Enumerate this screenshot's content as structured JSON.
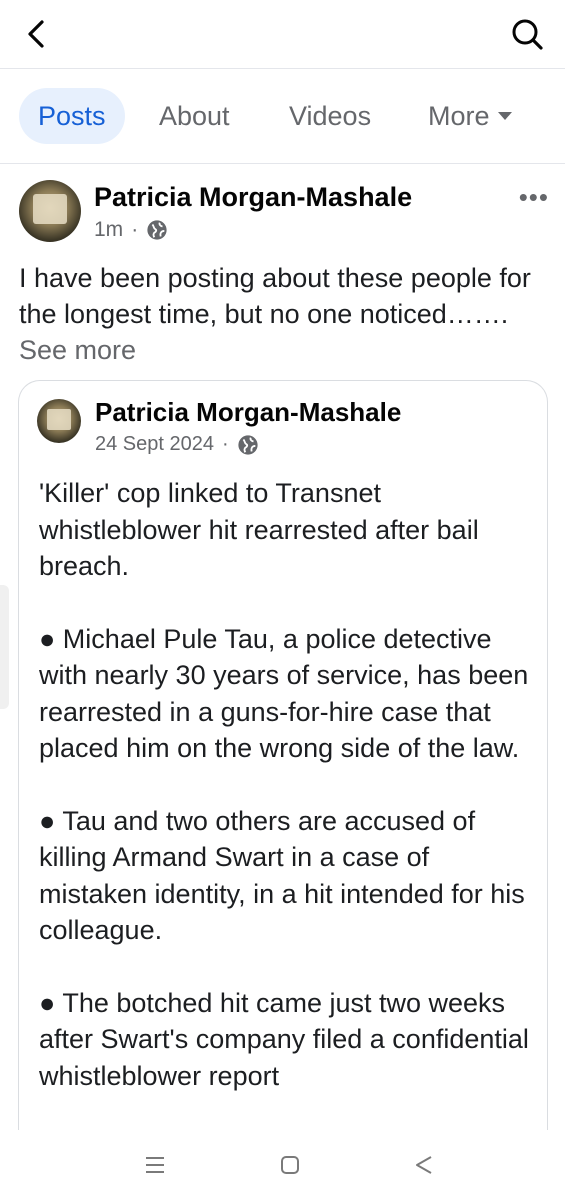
{
  "header": {
    "back_icon": "chevron-left-icon",
    "search_icon": "search-icon"
  },
  "tabs": [
    {
      "label": "Posts",
      "active": true
    },
    {
      "label": "About",
      "active": false
    },
    {
      "label": "Videos",
      "active": false
    },
    {
      "label": "More",
      "active": false
    }
  ],
  "post": {
    "author": "Patricia Morgan-Mashale",
    "time": "1m",
    "separator": "·",
    "text": "I have been posting about these people for the longest time, but no one noticed…….",
    "see_more": " See more",
    "more_options": "•••"
  },
  "shared_post": {
    "author": "Patricia Morgan-Mashale",
    "date": "24 Sept 2024",
    "separator": "·",
    "paragraphs": [
      "'Killer' cop linked to Transnet whistleblower hit rearrested after bail breach.",
      "● Michael Pule Tau, a police detective with nearly 30 years of service, has been rearrested in a guns-for-hire case that placed him on the wrong side of the law.",
      "● Tau and two others are accused of killing Armand Swart in a case of mistaken identity, in a hit intended for his colleague.",
      "● The botched hit came just two weeks after Swart's company filed a confidential whistleblower report"
    ]
  },
  "colors": {
    "accent": "#1660d6",
    "accent_bg": "#e7f0fd",
    "muted": "#65676b"
  }
}
